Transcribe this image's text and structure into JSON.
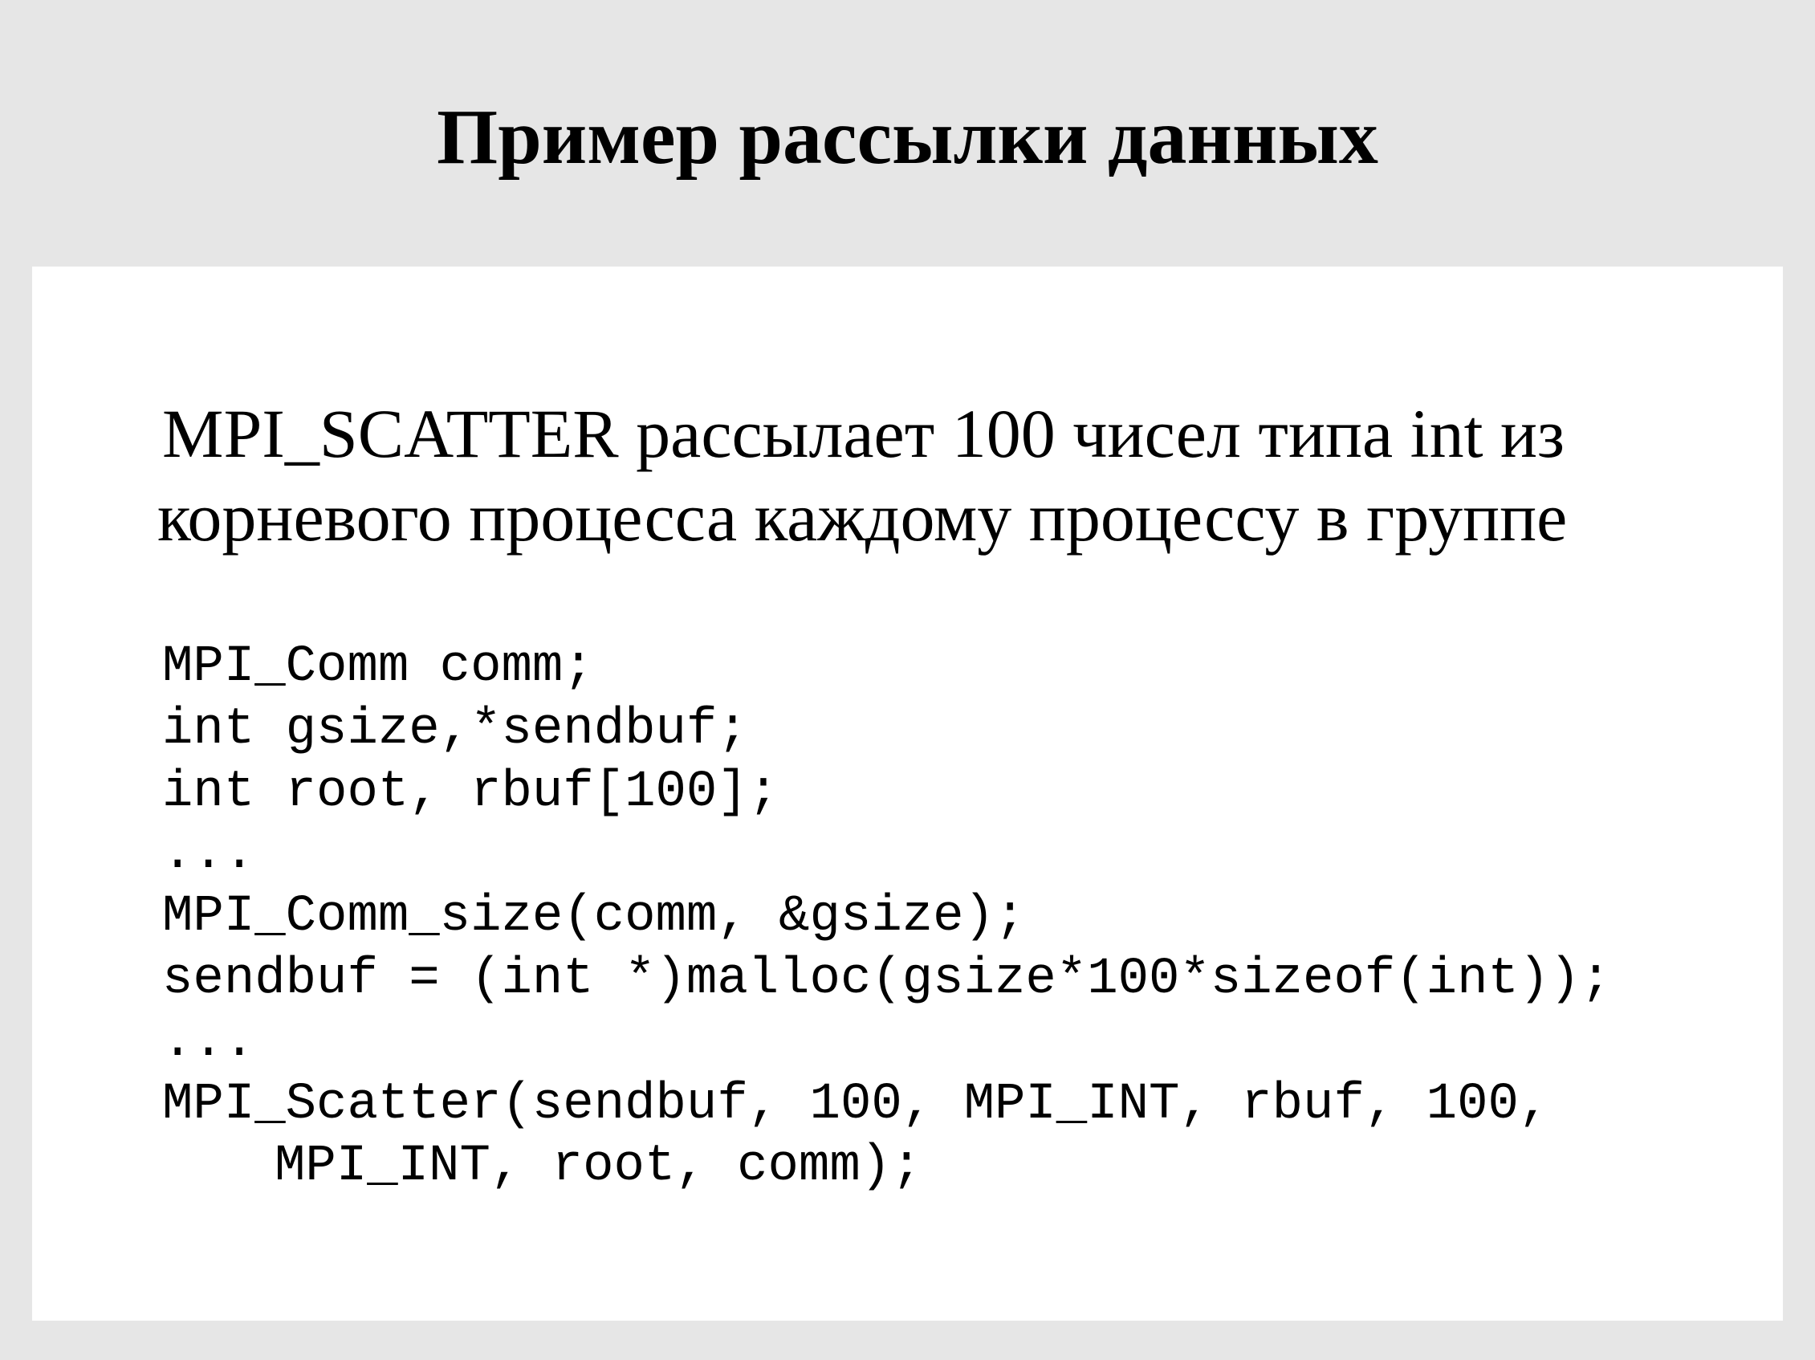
{
  "slide": {
    "title": "Пример рассылки данных",
    "description": [
      "MPI_SCATTER рассылает 100 чисел типа int из",
      "корневого процесса каждому процессу в группе"
    ],
    "code_lines": [
      "MPI_Comm comm;",
      "int gsize,*sendbuf;",
      "int root, rbuf[100];",
      "...",
      "MPI_Comm_size(comm, &gsize);",
      "sendbuf = (int *)malloc(gsize*100*sizeof(int));",
      "...",
      "MPI_Scatter(sendbuf, 100, MPI_INT, rbuf, 100,",
      "MPI_INT, root, comm);"
    ]
  },
  "colors": {
    "background": "#e6e6e6",
    "panel": "#ffffff",
    "text": "#000000"
  }
}
